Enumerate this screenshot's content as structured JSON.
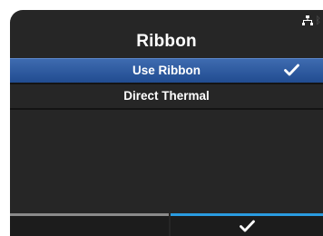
{
  "screen": {
    "title": "Ribbon"
  },
  "status_icons": [
    "network-icon",
    "bluetooth-icon"
  ],
  "menu": {
    "items": [
      {
        "label": "Use Ribbon",
        "selected": true,
        "checked": true
      },
      {
        "label": "Direct Thermal",
        "selected": false,
        "checked": false
      }
    ]
  },
  "softkeys": {
    "left": {
      "label": ""
    },
    "right": {
      "icon": "check-icon"
    }
  },
  "colors": {
    "background": "#262626",
    "selected_row": "#2f5c9e",
    "accent_softkey": "#2a9be0",
    "neutral_softkey": "#8a8a8a"
  }
}
